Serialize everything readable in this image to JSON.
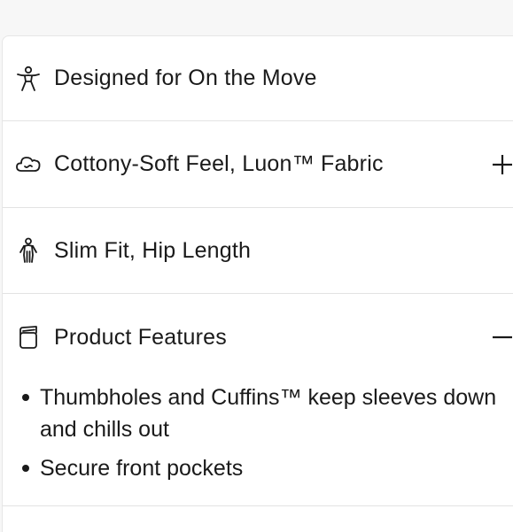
{
  "accordion": {
    "items": [
      {
        "label": "Designed for On the Move",
        "icon": "person-icon",
        "toggle": ""
      },
      {
        "label": "Cottony-Soft Feel, Luon™ Fabric",
        "icon": "cloud-icon",
        "toggle": "expand"
      },
      {
        "label": "Slim Fit, Hip Length",
        "icon": "body-fit-icon",
        "toggle": ""
      },
      {
        "label": "Product Features",
        "icon": "garment-tag-icon",
        "toggle": "collapse"
      }
    ],
    "features": [
      "Thumbholes and Cuffins™ keep sleeves down and chills out",
      "Secure front pockets"
    ]
  }
}
